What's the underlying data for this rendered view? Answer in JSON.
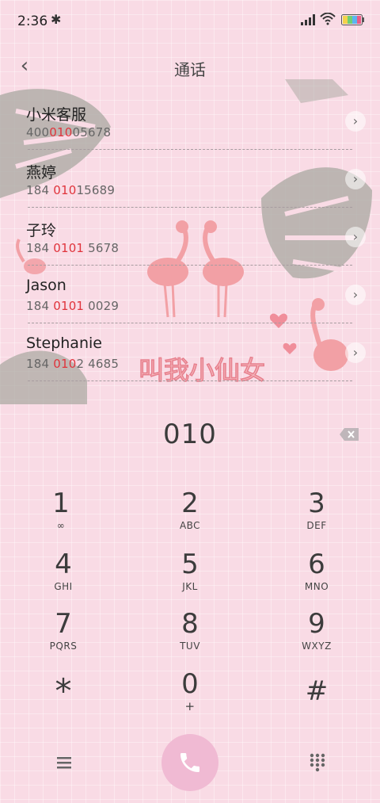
{
  "status_bar": {
    "time": "2:36",
    "icons": [
      "bluetooth-icon",
      "signal-icon",
      "wifi-icon",
      "battery-icon"
    ]
  },
  "header": {
    "title": "通话",
    "back_icon": "back-chevron-icon"
  },
  "contacts": [
    {
      "name": "小米客服",
      "number_pre": "400",
      "number_hl": "010",
      "number_post": "05678"
    },
    {
      "name": "燕婷",
      "number_pre": "184 ",
      "number_hl": "010",
      "number_post": "15689"
    },
    {
      "name": "子玲",
      "number_pre": "184 ",
      "number_hl": "0101",
      "number_post": " 5678"
    },
    {
      "name": "Jason",
      "number_pre": "184 ",
      "number_hl": "0101",
      "number_post": " 0029"
    },
    {
      "name": "Stephanie",
      "number_pre": "184 ",
      "number_hl": "010",
      "number_post": "2 4685"
    }
  ],
  "dial": {
    "number": "010",
    "backspace_icon": "backspace-icon"
  },
  "keypad": [
    {
      "digit": "1",
      "letters": "∞"
    },
    {
      "digit": "2",
      "letters": "ABC"
    },
    {
      "digit": "3",
      "letters": "DEF"
    },
    {
      "digit": "4",
      "letters": "GHI"
    },
    {
      "digit": "5",
      "letters": "JKL"
    },
    {
      "digit": "6",
      "letters": "MNO"
    },
    {
      "digit": "7",
      "letters": "PQRS"
    },
    {
      "digit": "8",
      "letters": "TUV"
    },
    {
      "digit": "9",
      "letters": "WXYZ"
    },
    {
      "digit": "*",
      "letters": ""
    },
    {
      "digit": "0",
      "letters": "+"
    },
    {
      "digit": "#",
      "letters": ""
    }
  ],
  "bottom_bar": {
    "icons": [
      "menu-icon",
      "phone-icon",
      "keypad-icon"
    ]
  },
  "decoration": {
    "banner_text": "叫我小仙女"
  },
  "colors": {
    "background": "#f9dbe5",
    "highlight": "#e0343c",
    "call_button": "#f0bad3"
  }
}
